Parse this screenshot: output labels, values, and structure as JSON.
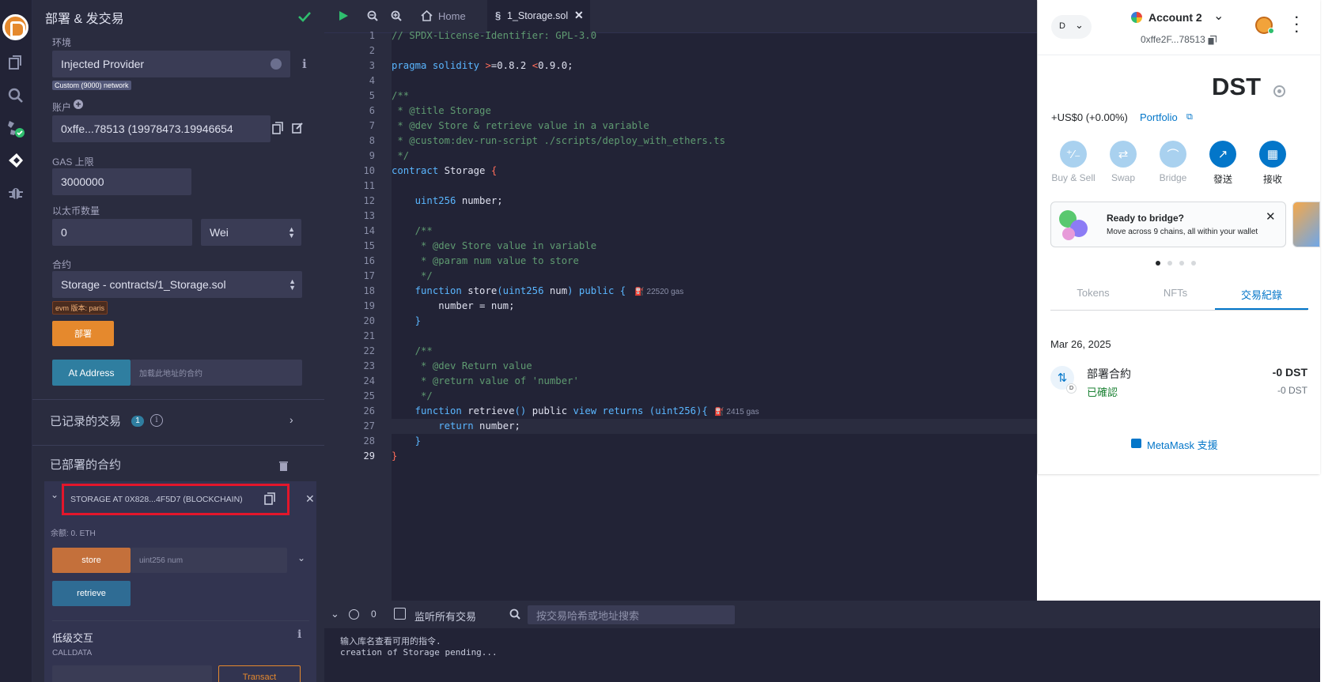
{
  "sidebar_panel": {
    "title": "部署 & 发交易",
    "env_label": "环境",
    "env_value": "Injected Provider",
    "network_tag": "Custom (9000) network",
    "account_label": "账户",
    "account_value": "0xffe...78513 (19978473.19946654",
    "gas_label": "GAS 上限",
    "gas_value": "3000000",
    "value_label": "以太币数量",
    "value_amount": "0",
    "value_unit": "Wei",
    "contract_label": "合约",
    "contract_value": "Storage - contracts/1_Storage.sol",
    "evm_tag": "evm 版本: paris",
    "deploy_button": "部署",
    "at_address_button": "At Address",
    "at_address_placeholder": "加载此地址的合约",
    "recorded_tx_label": "已记录的交易",
    "recorded_tx_count": "1",
    "deployed_label": "已部署的合约",
    "instance_title": "STORAGE AT 0X828...4F5D7 (BLOCKCHAIN)",
    "balance": "余额: 0. ETH",
    "store_button": "store",
    "store_placeholder": "uint256 num",
    "retrieve_button": "retrieve",
    "low_level_label": "低级交互",
    "calldata_label": "CALLDATA",
    "transact_button": "Transact"
  },
  "editor": {
    "tab_home": "Home",
    "tab_file": "1_Storage.sol",
    "line_numbers": [
      "1",
      "2",
      "3",
      "4",
      "5",
      "6",
      "7",
      "8",
      "9",
      "10",
      "11",
      "12",
      "13",
      "14",
      "15",
      "16",
      "17",
      "18",
      "19",
      "20",
      "21",
      "22",
      "23",
      "24",
      "25",
      "26",
      "27",
      "28",
      "29"
    ],
    "lines": {
      "l1": "// SPDX-License-Identifier: GPL-3.0",
      "l3a": "pragma solidity ",
      "l3b": ">",
      "l3c": "=0.8.2 ",
      "l3d": "<",
      "l3e": "0.9.0;",
      "l5": "/**",
      "l6": " * @title Storage",
      "l7": " * @dev Store & retrieve value in a variable",
      "l8": " * @custom:dev-run-script ./scripts/deploy_with_ethers.ts",
      "l9": " */",
      "l10a": "contract",
      "l10b": " Storage ",
      "l10c": "{",
      "l12a": "    uint256",
      "l12b": " number;",
      "l14": "    /**",
      "l15": "     * @dev Store value in variable",
      "l16": "     * @param num value to store",
      "l17": "     */",
      "l18a": "    function",
      "l18b": " store",
      "l18c": "(uint256",
      "l18d": " num",
      "l18e": ")",
      "l18f": " public ",
      "l18g": "{",
      "l18gas": "22520 gas",
      "l19": "        number = num;",
      "l20": "    }",
      "l22": "    /**",
      "l23": "     * @dev Return value",
      "l24": "     * @return value of 'number'",
      "l25": "     */",
      "l26a": "    function",
      "l26b": " retrieve",
      "l26c": "()",
      "l26d": " public ",
      "l26e": "view",
      "l26f": " returns ",
      "l26g": "(uint256){",
      "l26gas": "2415 gas",
      "l27a": "        return",
      "l27b": " number;",
      "l28": "    }",
      "l29": "}"
    }
  },
  "terminal": {
    "count": "0",
    "listen_label": "监听所有交易",
    "search_placeholder": "按交易哈希或地址搜索",
    "line1": "输入库名查看可用的指令.",
    "line2": "creation of Storage pending..."
  },
  "metamask": {
    "network_letter": "D",
    "account_name": "Account 2",
    "account_address": "0xffe2F...78513",
    "balance": "DST",
    "fiat": "+US$0 (+0.00%)",
    "portfolio": "Portfolio",
    "actions": [
      "Buy & Sell",
      "Swap",
      "Bridge",
      "發送",
      "接收"
    ],
    "banner_title": "Ready to bridge?",
    "banner_text": "Move across 9 chains, all within your wallet",
    "tabs": [
      "Tokens",
      "NFTs",
      "交易紀錄"
    ],
    "date": "Mar 26, 2025",
    "tx_title": "部署合約",
    "tx_status": "已確認",
    "tx_amount": "-0 DST",
    "tx_amount2": "-0 DST",
    "tx_badge": "D",
    "support": "MetaMask 支援"
  },
  "colors": {
    "orange": "#e5892d",
    "teal": "#2f7ea0",
    "mm_blue": "#0376c9",
    "highlight_red": "#e3162b"
  }
}
